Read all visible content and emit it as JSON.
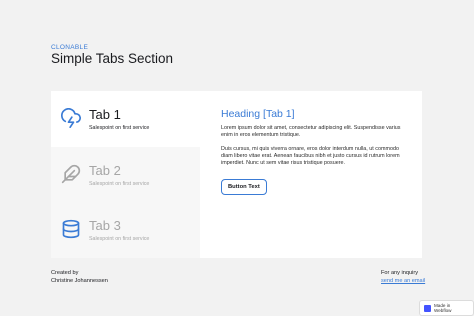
{
  "header": {
    "eyebrow": "CLONABLE",
    "title": "Simple Tabs Section"
  },
  "tabs": [
    {
      "label": "Tab 1",
      "subtitle": "Salespoint on first service",
      "icon": "cloud-lightning-icon",
      "active": true
    },
    {
      "label": "Tab 2",
      "subtitle": "Salespoint on first service",
      "icon": "feather-icon",
      "active": false
    },
    {
      "label": "Tab 3",
      "subtitle": "Salespoint on first service",
      "icon": "database-icon",
      "active": false
    }
  ],
  "pane": {
    "heading": "Heading [Tab 1]",
    "paragraph1": "Lorem ipsum dolor sit amet, consectetur adipiscing elit. Suspendisse varius enim in eros elementum tristique.",
    "paragraph2": "Duis cursus, mi quis viverra ornare, eros dolor interdum nulla, ut commodo diam libero vitae erat. Aenean faucibus nibh et justo cursus id rutrum lorem imperdiet. Nunc ut sem vitae risus tristique posuere.",
    "button_label": "Button Text"
  },
  "footer": {
    "created_by": "Created by",
    "author": "Christine Johannessen",
    "inquiry": "For any inquiry",
    "email_link": "send me an email"
  },
  "badge": {
    "label": "Made in Webflow"
  },
  "colors": {
    "accent": "#3a7bd5",
    "active_icon": "#3a7bd5",
    "inactive_icon": "#a6a6a6"
  }
}
